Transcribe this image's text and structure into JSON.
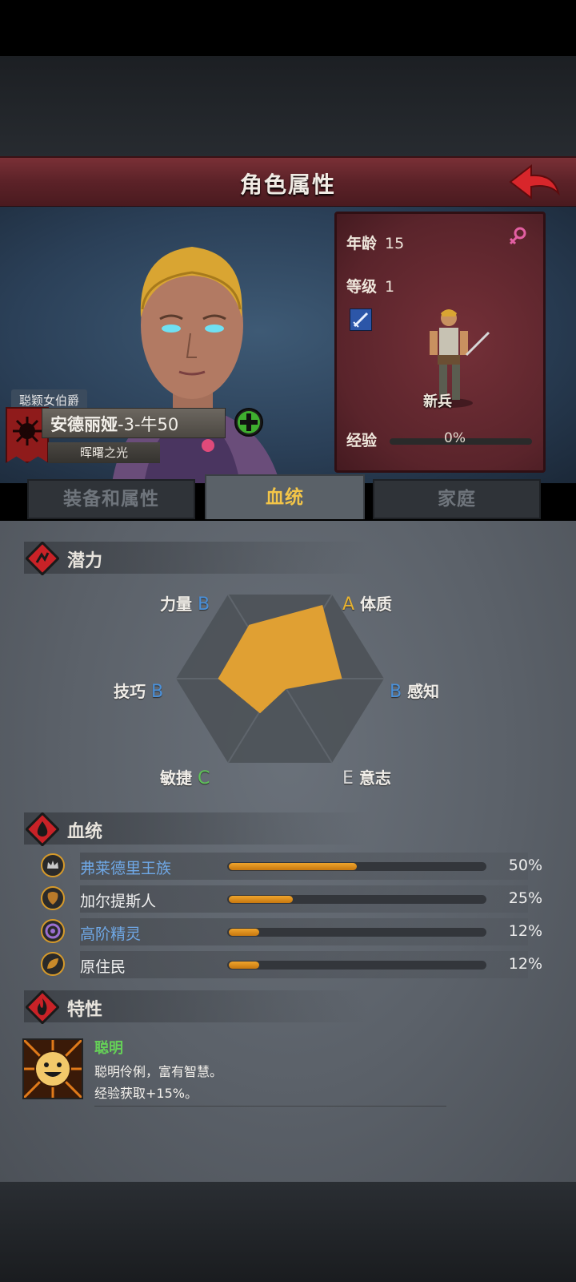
{
  "header": {
    "title": "角色属性"
  },
  "character": {
    "title_tag": "聪颖女伯爵",
    "name": "安德丽娅",
    "name_suffix": "-3-牛50",
    "subtitle": "晖曙之光"
  },
  "stats": {
    "age_label": "年龄",
    "age_value": "15",
    "level_label": "等级",
    "level_value": "1",
    "class_name": "新兵",
    "exp_label": "经验",
    "exp_value": "0%",
    "exp_progress": 0
  },
  "tabs": [
    {
      "label": "装备和属性",
      "active": false
    },
    {
      "label": "血统",
      "active": true
    },
    {
      "label": "家庭",
      "active": false
    }
  ],
  "potential": {
    "title": "潜力",
    "attributes": [
      {
        "name": "力量",
        "grade": "B",
        "grade_color": "#4a90d9"
      },
      {
        "name": "体质",
        "grade": "A",
        "grade_color": "#e6b231"
      },
      {
        "name": "感知",
        "grade": "B",
        "grade_color": "#4a90d9"
      },
      {
        "name": "意志",
        "grade": "E",
        "grade_color": "#d7d7d7"
      },
      {
        "name": "敏捷",
        "grade": "C",
        "grade_color": "#5fc35a"
      },
      {
        "name": "技巧",
        "grade": "B",
        "grade_color": "#4a90d9"
      }
    ],
    "radar_fill_color": "#e0a033"
  },
  "bloodline": {
    "title": "血统",
    "items": [
      {
        "name": "弗莱德里王族",
        "name_color": "#6fa8e6",
        "percent": "50%",
        "value": 0.5
      },
      {
        "name": "加尔提斯人",
        "name_color": "#f0f0f0",
        "percent": "25%",
        "value": 0.25
      },
      {
        "name": "高阶精灵",
        "name_color": "#6fa8e6",
        "percent": "12%",
        "value": 0.12
      },
      {
        "name": "原住民",
        "name_color": "#f0f0f0",
        "percent": "12%",
        "value": 0.12
      }
    ]
  },
  "traits": {
    "title": "特性",
    "items": [
      {
        "name": "聪明",
        "desc_line1": "聪明伶俐，富有智慧。",
        "desc_line2": "经验获取+15%。"
      }
    ]
  }
}
